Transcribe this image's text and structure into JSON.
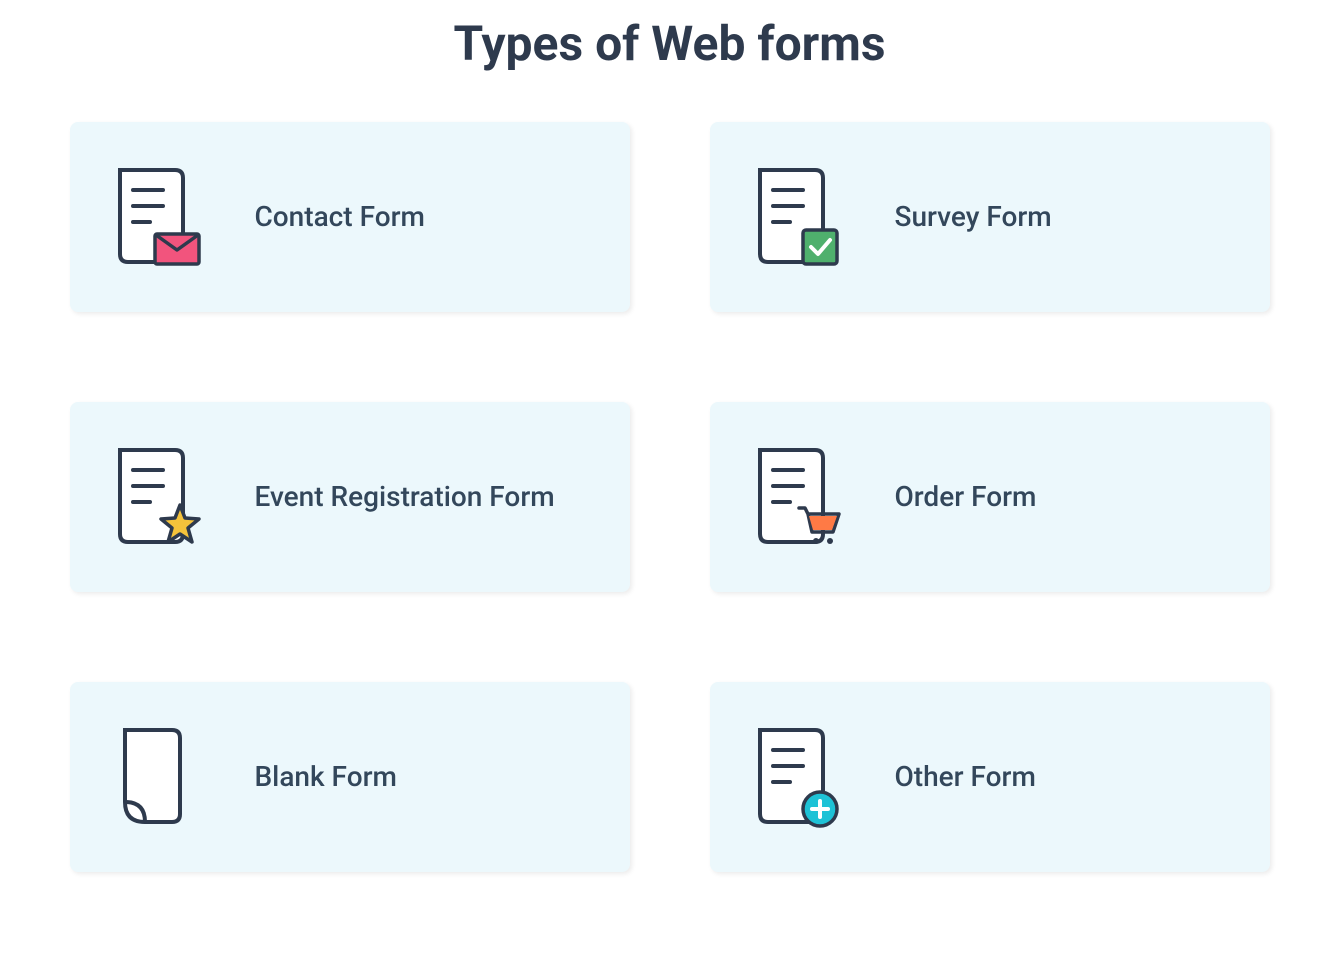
{
  "title": "Types of Web forms",
  "cards": [
    {
      "label": "Contact Form",
      "icon": "contact-form-icon"
    },
    {
      "label": "Survey Form",
      "icon": "survey-form-icon"
    },
    {
      "label": "Event Registration Form",
      "icon": "event-form-icon"
    },
    {
      "label": "Order Form",
      "icon": "order-form-icon"
    },
    {
      "label": "Blank Form",
      "icon": "blank-form-icon"
    },
    {
      "label": "Other Form",
      "icon": "other-form-icon"
    }
  ]
}
